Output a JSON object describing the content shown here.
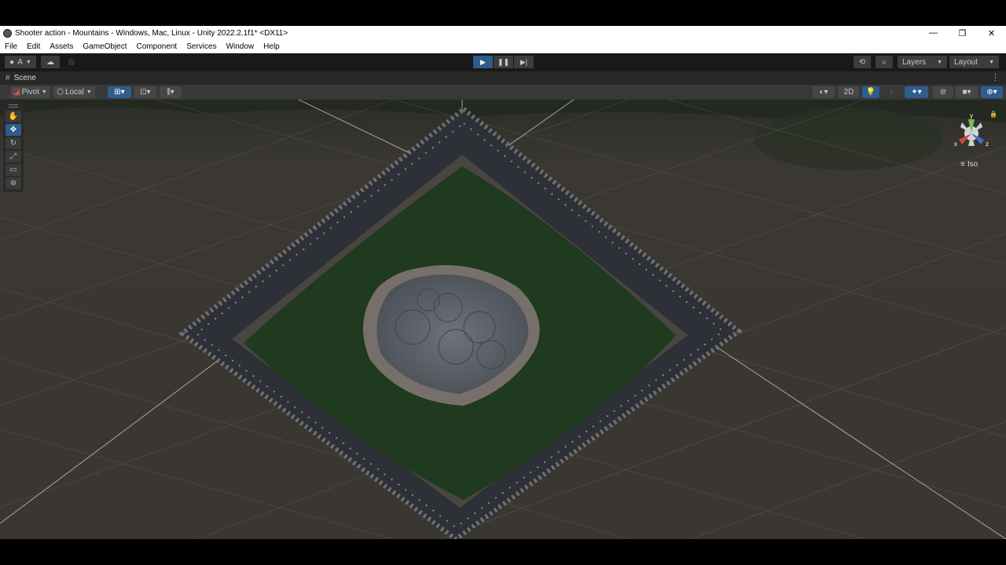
{
  "window": {
    "title": "Shooter action - Mountains - Windows, Mac, Linux - Unity 2022.2.1f1* <DX11>",
    "controls": {
      "minimize": "—",
      "restore": "❐",
      "close": "✕"
    }
  },
  "menu": [
    "File",
    "Edit",
    "Assets",
    "GameObject",
    "Component",
    "Services",
    "Window",
    "Help"
  ],
  "toolbar": {
    "account_label": "A",
    "layers_label": "Layers",
    "layout_label": "Layout"
  },
  "scene": {
    "tab_label": "Scene",
    "pivot_label": "Pivot",
    "local_label": "Local",
    "mode_2d_label": "2D",
    "gizmo_view_label": "Iso",
    "axis_x": "x",
    "axis_y": "y",
    "axis_z": "z"
  },
  "colors": {
    "accent": "#2f5c8c",
    "terrain_grass": "#1f3a1e",
    "terrain_rock": "#5f646b"
  },
  "icons": {
    "tools": [
      "hand-tool-icon",
      "move-tool-icon",
      "rotate-tool-icon",
      "scale-tool-icon",
      "rect-tool-icon",
      "transform-tool-icon"
    ]
  }
}
